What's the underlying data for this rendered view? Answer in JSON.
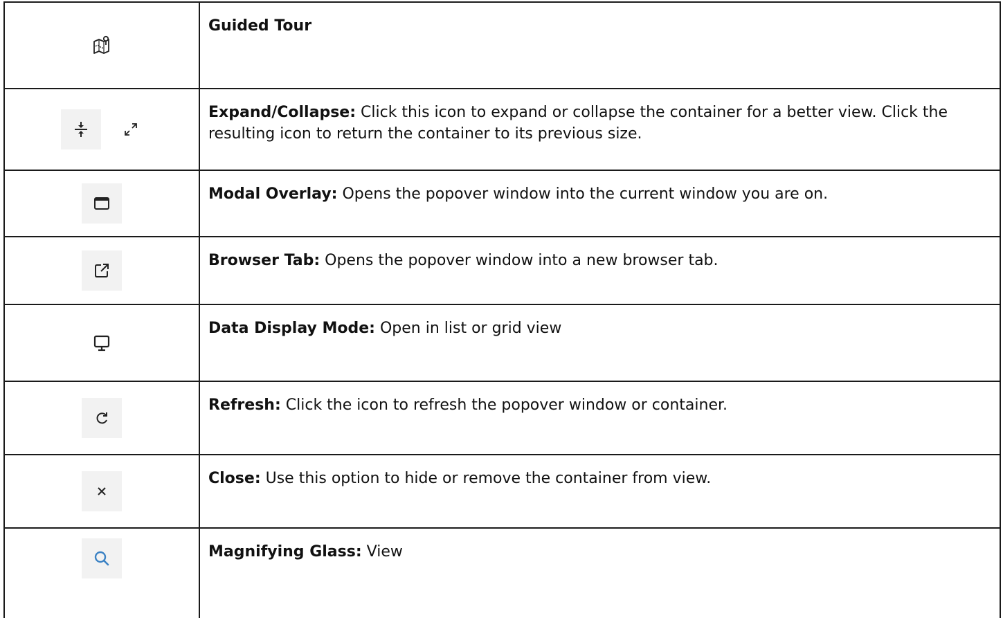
{
  "rows": [
    {
      "icons": [
        "guided-tour-icon"
      ],
      "label": "Guided Tour",
      "text": ""
    },
    {
      "icons": [
        "collapse-arrows-icon",
        "expand-arrows-icon"
      ],
      "label": "Expand/Collapse:",
      "text": " Click this icon to expand or collapse the container for a better view. Click the resulting icon to return the container to its previous size."
    },
    {
      "icons": [
        "window-icon"
      ],
      "label": "Modal Overlay:",
      "text": " Opens the popover window into the current window you are on."
    },
    {
      "icons": [
        "external-link-icon"
      ],
      "label": "Browser Tab:",
      "text": " Opens the popover window into a new browser tab."
    },
    {
      "icons": [
        "monitor-icon"
      ],
      "label": "Data Display Mode:",
      "text": " Open in list or grid view"
    },
    {
      "icons": [
        "refresh-icon"
      ],
      "label": "Refresh:",
      "text": " Click the icon to refresh the popover window or container."
    },
    {
      "icons": [
        "close-icon"
      ],
      "label": "Close:",
      "text": " Use this option to hide or remove the container from view."
    },
    {
      "icons": [
        "search-icon"
      ],
      "label": "Magnifying Glass:",
      "text": " View"
    }
  ],
  "colors": {
    "border": "#1a1a1a",
    "icon_bg": "#f2f2f2",
    "icon_dark": "#222222",
    "search_blue": "#3b82c4"
  }
}
